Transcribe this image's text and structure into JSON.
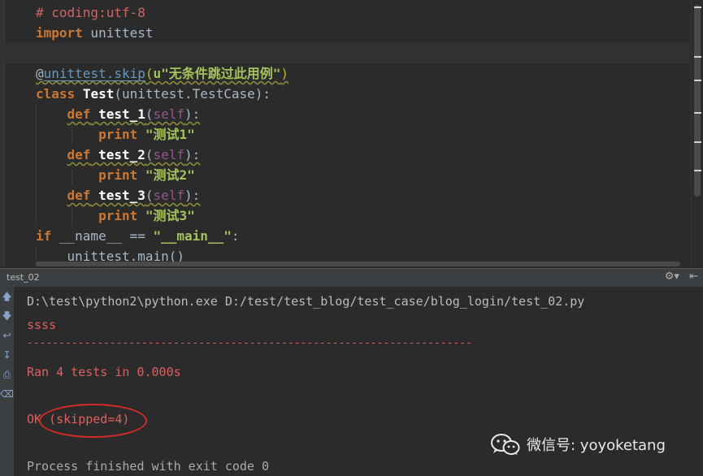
{
  "editor": {
    "lines": [
      {
        "id": "l1",
        "segments": [
          {
            "t": "# coding:utf-8",
            "c": "cm"
          }
        ]
      },
      {
        "id": "l2",
        "segments": [
          {
            "t": "import",
            "c": "kw"
          },
          {
            "t": " unittest",
            "c": "plain"
          }
        ]
      },
      {
        "id": "l3",
        "current": true,
        "segments": [
          {
            "t": "",
            "c": "plain"
          }
        ]
      },
      {
        "id": "l4",
        "segments": [
          {
            "t": "@",
            "c": "plain"
          },
          {
            "t": "unittest.skip",
            "c": "deconame"
          },
          {
            "t": "(",
            "c": "deco"
          },
          {
            "t": "u\"无条件跳过此用例\"",
            "c": "strg"
          },
          {
            "t": ")",
            "c": "deco"
          }
        ]
      },
      {
        "id": "l5",
        "segments": [
          {
            "t": "class",
            "c": "kw"
          },
          {
            "t": " ",
            "c": "plain"
          },
          {
            "t": "Test",
            "c": "cls"
          },
          {
            "t": "(unittest.TestCase):",
            "c": "plain"
          }
        ]
      },
      {
        "id": "l6",
        "indent": 1,
        "segments": [
          {
            "t": "def",
            "c": "kw"
          },
          {
            "t": " ",
            "c": "plain"
          },
          {
            "t": "test_1",
            "c": "fn"
          },
          {
            "t": "(",
            "c": "plain"
          },
          {
            "t": "self",
            "c": "slf"
          },
          {
            "t": "):",
            "c": "plain"
          }
        ]
      },
      {
        "id": "l7",
        "indent": 2,
        "segments": [
          {
            "t": "print",
            "c": "kw"
          },
          {
            "t": " ",
            "c": "plain"
          },
          {
            "t": "\"测试1\"",
            "c": "strg"
          }
        ]
      },
      {
        "id": "l8",
        "indent": 1,
        "segments": [
          {
            "t": "def",
            "c": "kw"
          },
          {
            "t": " ",
            "c": "plain"
          },
          {
            "t": "test_2",
            "c": "fn"
          },
          {
            "t": "(",
            "c": "plain"
          },
          {
            "t": "self",
            "c": "slf"
          },
          {
            "t": "):",
            "c": "plain"
          }
        ]
      },
      {
        "id": "l9",
        "indent": 2,
        "segments": [
          {
            "t": "print",
            "c": "kw"
          },
          {
            "t": " ",
            "c": "plain"
          },
          {
            "t": "\"测试2\"",
            "c": "strg"
          }
        ]
      },
      {
        "id": "l10",
        "indent": 1,
        "segments": [
          {
            "t": "def",
            "c": "kw"
          },
          {
            "t": " ",
            "c": "plain"
          },
          {
            "t": "test_3",
            "c": "fn"
          },
          {
            "t": "(",
            "c": "plain"
          },
          {
            "t": "self",
            "c": "slf"
          },
          {
            "t": "):",
            "c": "plain"
          }
        ]
      },
      {
        "id": "l11",
        "indent": 2,
        "segments": [
          {
            "t": "print",
            "c": "kw"
          },
          {
            "t": " ",
            "c": "plain"
          },
          {
            "t": "\"测试3\"",
            "c": "strg"
          }
        ]
      },
      {
        "id": "l12",
        "segments": [
          {
            "t": "if",
            "c": "kw"
          },
          {
            "t": " __name__ == ",
            "c": "plain"
          },
          {
            "t": "\"__main__\"",
            "c": "strg"
          },
          {
            "t": ":",
            "c": "plain"
          }
        ]
      },
      {
        "id": "l13",
        "indent": 1,
        "segments": [
          {
            "t": "unittest.main()",
            "c": "plain"
          }
        ]
      }
    ]
  },
  "run_panel": {
    "tab_label": "test_02",
    "settings_icon": "gear-icon",
    "hide_icon": "hide-panel-icon",
    "side_icons": [
      "up-arrow-icon",
      "down-arrow-icon",
      "soft-wrap-icon",
      "scroll-to-end-icon",
      "print-icon",
      "trash-icon"
    ],
    "console": {
      "command": "D:\\test\\python2\\python.exe D:/test/test_blog/test_case/blog_login/test_02.py",
      "output1": "ssss",
      "separator": "----------------------------------------------------------------------",
      "ran": "Ran 4 tests in 0.000s",
      "result": "OK (skipped=4)",
      "exit": "Process finished with exit code 0"
    }
  },
  "watermark": {
    "text": "微信号: yoyoketang",
    "icon": "wechat-logo-icon"
  },
  "colors": {
    "editor_bg": "#2b2b2b",
    "keyword": "#cc7832",
    "string": "#a5c25c",
    "comment": "#cc6666",
    "console_error": "#e05f5f",
    "highlight_oval": "#d52b2b"
  }
}
